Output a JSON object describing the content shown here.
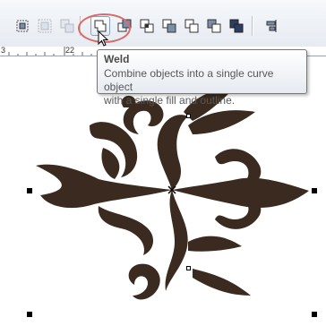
{
  "toolbar": {
    "buttons": [
      {
        "name": "align-distribute",
        "icon": "align-icon"
      },
      {
        "name": "group",
        "icon": "group-icon"
      },
      {
        "name": "ungroup",
        "icon": "ungroup-icon"
      },
      {
        "name": "weld",
        "icon": "weld-icon"
      },
      {
        "name": "trim",
        "icon": "trim-icon"
      },
      {
        "name": "intersect",
        "icon": "intersect-icon"
      },
      {
        "name": "simplify",
        "icon": "simplify-icon"
      },
      {
        "name": "front-minus-back",
        "icon": "front-minus-back-icon"
      },
      {
        "name": "back-minus-front",
        "icon": "back-minus-front-icon"
      },
      {
        "name": "create-boundary",
        "icon": "boundary-icon"
      },
      {
        "name": "align",
        "icon": "align-right-icon"
      }
    ]
  },
  "ruler": {
    "labels": [
      "3",
      "22"
    ]
  },
  "tooltip": {
    "title": "Weld",
    "description_line1": "Combine objects into a single curve object",
    "description_line2": "with a single fill and outline."
  },
  "colors": {
    "ornament": "#3a2a1f",
    "highlight": "#d96a6a",
    "toolbar_bg": "#e6ebf2"
  }
}
